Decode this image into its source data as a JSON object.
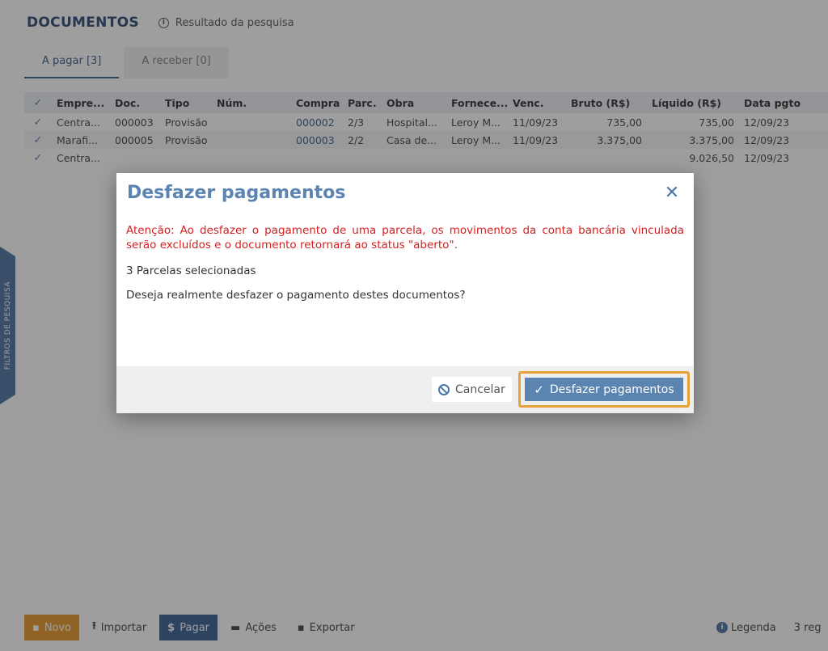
{
  "page": {
    "title": "DOCUMENTOS",
    "result_label": "Resultado da pesquisa",
    "tabs": [
      {
        "label": "A pagar [3]"
      },
      {
        "label": "A receber [0]"
      }
    ],
    "side_tab_label": "FILTROS DE PESQUISA"
  },
  "table": {
    "headers": [
      "Empre...",
      "Doc.",
      "Tipo",
      "Núm.",
      "Compra",
      "Parc.",
      "Obra",
      "Fornece...",
      "Venc.",
      "Bruto (R$)",
      "Líquido (R$)",
      "Data pgto."
    ],
    "rows": [
      {
        "empresa": "Centra...",
        "doc": "000003",
        "tipo": "Provisão",
        "num": "",
        "compra": "000002",
        "parc": "2/3",
        "obra": "Hospital...",
        "fornecedor": "Leroy M...",
        "venc": "11/09/23",
        "bruto": "735,00",
        "liquido": "735,00",
        "data_pgto": "12/09/23"
      },
      {
        "empresa": "Marafi...",
        "doc": "000005",
        "tipo": "Provisão",
        "num": "",
        "compra": "000003",
        "parc": "2/2",
        "obra": "Casa de...",
        "fornecedor": "Leroy M...",
        "venc": "11/09/23",
        "bruto": "3.375,00",
        "liquido": "3.375,00",
        "data_pgto": "12/09/23"
      },
      {
        "empresa": "Centra...",
        "doc": "",
        "tipo": "",
        "num": "",
        "compra": "",
        "parc": "",
        "obra": "",
        "fornecedor": "",
        "venc": "",
        "bruto": "",
        "liquido": "9.026,50",
        "data_pgto": "12/09/23"
      }
    ]
  },
  "toolbar": {
    "novo": "Novo",
    "importar": "Importar",
    "pagar": "Pagar",
    "acoes": "Ações",
    "exportar": "Exportar",
    "legenda": "Legenda",
    "count": "3 reg"
  },
  "modal": {
    "title": "Desfazer pagamentos",
    "warning": "Atenção: Ao desfazer o pagamento de uma parcela, os movimentos da conta bancária vinculada serão excluídos e o documento retornará ao status \"aberto\".",
    "selected": "3 Parcelas selecionadas",
    "question": "Deseja realmente desfazer o pagamento destes documentos?",
    "cancel_label": "Cancelar",
    "confirm_label": "Desfazer pagamentos"
  },
  "colors": {
    "primary": "#5b84b1",
    "highlight": "#e8a03a",
    "warning": "#d42020"
  }
}
